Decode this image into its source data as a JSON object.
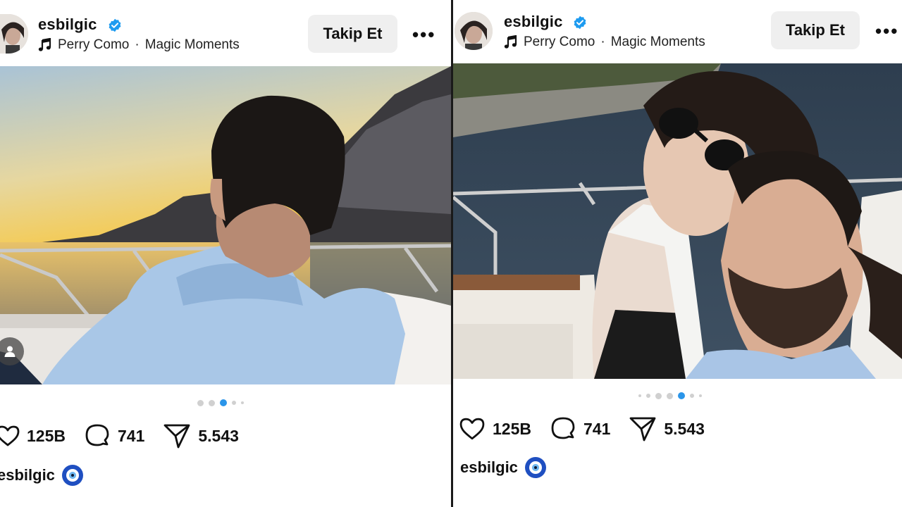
{
  "posts": [
    {
      "username": "esbilgic",
      "verified": true,
      "music": {
        "icon": "music-note-icon",
        "artist": "Perry Como",
        "separator": "·",
        "track": "Magic Moments"
      },
      "follow_label": "Takip Et",
      "more_label": "•••",
      "carousel": {
        "total": 5,
        "active_index": 2
      },
      "likes": "125B",
      "comments": "741",
      "shares": "5.543",
      "caption_username": "esbilgic",
      "caption_emoji": "nazar-amulet-icon"
    },
    {
      "username": "esbilgic",
      "verified": true,
      "music": {
        "icon": "music-note-icon",
        "artist": "Perry Como",
        "separator": "·",
        "track": "Magic Moments"
      },
      "follow_label": "Takip Et",
      "more_label": "•••",
      "carousel": {
        "total": 7,
        "active_index": 4
      },
      "likes": "125B",
      "comments": "741",
      "shares": "5.543",
      "caption_username": "esbilgic",
      "caption_emoji": "nazar-amulet-icon"
    }
  ],
  "colors": {
    "verified_blue": "#1d9bf0",
    "carousel_active": "#2b95e9",
    "follow_bg": "#efefef"
  }
}
